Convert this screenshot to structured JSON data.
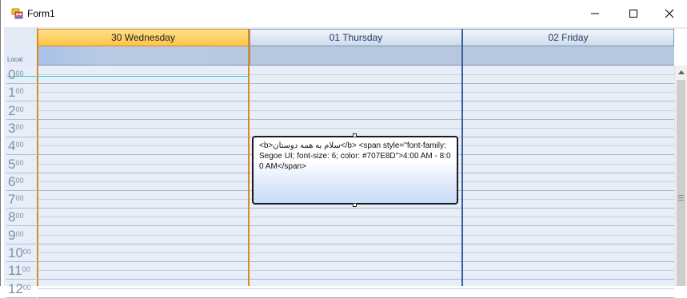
{
  "window": {
    "title": "Form1",
    "icon": "windows-form-icon",
    "controls": {
      "minimize": "minimize-icon",
      "maximize": "maximize-icon",
      "close": "close-icon"
    }
  },
  "scheduler": {
    "timezone_label": "Local",
    "days": [
      {
        "label": "30 Wednesday",
        "today": true
      },
      {
        "label": "01 Thursday",
        "today": false
      },
      {
        "label": "02 Friday",
        "today": false
      }
    ],
    "hours": [
      {
        "h": "0",
        "m": "00"
      },
      {
        "h": "1",
        "m": "00"
      },
      {
        "h": "2",
        "m": "00"
      },
      {
        "h": "3",
        "m": "00"
      },
      {
        "h": "4",
        "m": "00"
      },
      {
        "h": "5",
        "m": "00"
      },
      {
        "h": "6",
        "m": "00"
      },
      {
        "h": "7",
        "m": "00"
      },
      {
        "h": "8",
        "m": "00"
      },
      {
        "h": "9",
        "m": "00"
      },
      {
        "h": "10",
        "m": "00"
      },
      {
        "h": "11",
        "m": "00"
      },
      {
        "h": "12",
        "m": "00"
      }
    ],
    "appointment": {
      "text": "<b>سلام به همه دوستان</b>  <span style=\"font-family: Segoe UI; font-size: 6; color: #707E8D\">4:00 AM - 8:00 AM</span>"
    },
    "colors": {
      "today_header": "#ffc447",
      "today_border": "#d88a2a",
      "day_border": "#3a5f9e",
      "now_line": "#2fd0c8",
      "hour_text": "#7c8fae"
    }
  }
}
